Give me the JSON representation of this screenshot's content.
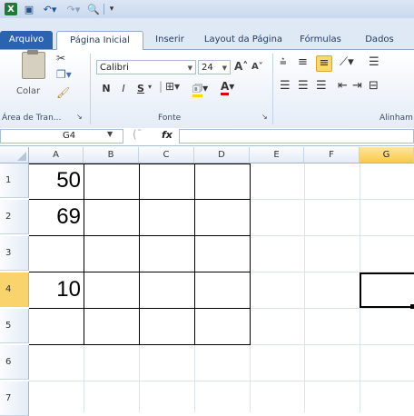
{
  "quick_access": {
    "app_icon": "excel-icon",
    "save_icon": "save-icon",
    "undo_icon": "undo-icon",
    "redo_icon": "redo-icon",
    "print_preview_icon": "print-preview-icon"
  },
  "tabs": [
    {
      "label": "Arquivo"
    },
    {
      "label": "Página Inicial"
    },
    {
      "label": "Inserir"
    },
    {
      "label": "Layout da Página"
    },
    {
      "label": "Fórmulas"
    },
    {
      "label": "Dados"
    }
  ],
  "ribbon": {
    "clipboard": {
      "paste_label": "Colar",
      "group_label": "Área de Tran..."
    },
    "font": {
      "font_name": "Calibri",
      "font_size": "24",
      "bold": "N",
      "italic": "I",
      "underline": "S",
      "group_label": "Fonte"
    },
    "alignment": {
      "group_label": "Alinham"
    }
  },
  "formula_bar": {
    "name_box": "G4",
    "fx_label": "fx",
    "formula": ""
  },
  "grid": {
    "columns": [
      "A",
      "B",
      "C",
      "D",
      "E",
      "F",
      "G"
    ],
    "selected_column": "G",
    "rows": [
      "1",
      "2",
      "3",
      "4",
      "5",
      "6",
      "7"
    ],
    "selected_row": "4",
    "cells": {
      "A1": "50",
      "A2": "69",
      "A4": "10"
    },
    "active_cell": "G4"
  },
  "colors": {
    "file_tab": "#2a64b0",
    "header_selected": "#f8c94d",
    "gridline": "#dbe3ee"
  }
}
